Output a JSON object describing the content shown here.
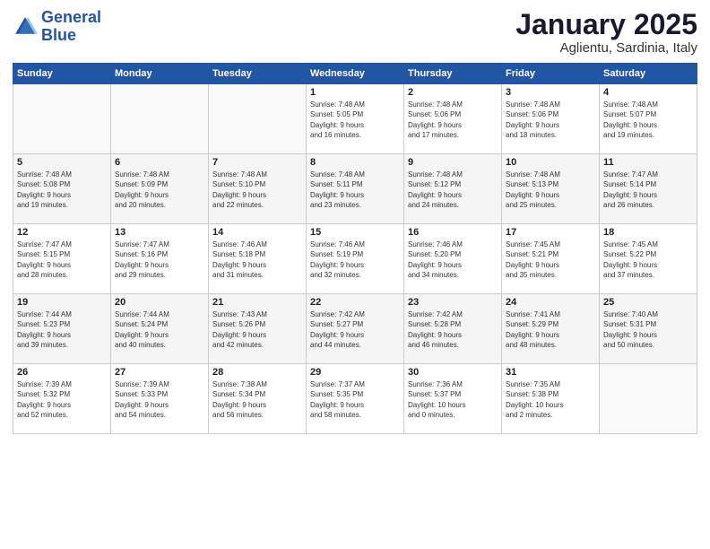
{
  "logo": {
    "line1": "General",
    "line2": "Blue"
  },
  "calendar": {
    "title": "January 2025",
    "subtitle": "Aglientu, Sardinia, Italy"
  },
  "days_header": [
    "Sunday",
    "Monday",
    "Tuesday",
    "Wednesday",
    "Thursday",
    "Friday",
    "Saturday"
  ],
  "weeks": [
    [
      {
        "day": "",
        "info": ""
      },
      {
        "day": "",
        "info": ""
      },
      {
        "day": "",
        "info": ""
      },
      {
        "day": "1",
        "info": "Sunrise: 7:48 AM\nSunset: 5:05 PM\nDaylight: 9 hours\nand 16 minutes."
      },
      {
        "day": "2",
        "info": "Sunrise: 7:48 AM\nSunset: 5:06 PM\nDaylight: 9 hours\nand 17 minutes."
      },
      {
        "day": "3",
        "info": "Sunrise: 7:48 AM\nSunset: 5:06 PM\nDaylight: 9 hours\nand 18 minutes."
      },
      {
        "day": "4",
        "info": "Sunrise: 7:48 AM\nSunset: 5:07 PM\nDaylight: 9 hours\nand 19 minutes."
      }
    ],
    [
      {
        "day": "5",
        "info": "Sunrise: 7:48 AM\nSunset: 5:08 PM\nDaylight: 9 hours\nand 19 minutes."
      },
      {
        "day": "6",
        "info": "Sunrise: 7:48 AM\nSunset: 5:09 PM\nDaylight: 9 hours\nand 20 minutes."
      },
      {
        "day": "7",
        "info": "Sunrise: 7:48 AM\nSunset: 5:10 PM\nDaylight: 9 hours\nand 22 minutes."
      },
      {
        "day": "8",
        "info": "Sunrise: 7:48 AM\nSunset: 5:11 PM\nDaylight: 9 hours\nand 23 minutes."
      },
      {
        "day": "9",
        "info": "Sunrise: 7:48 AM\nSunset: 5:12 PM\nDaylight: 9 hours\nand 24 minutes."
      },
      {
        "day": "10",
        "info": "Sunrise: 7:48 AM\nSunset: 5:13 PM\nDaylight: 9 hours\nand 25 minutes."
      },
      {
        "day": "11",
        "info": "Sunrise: 7:47 AM\nSunset: 5:14 PM\nDaylight: 9 hours\nand 26 minutes."
      }
    ],
    [
      {
        "day": "12",
        "info": "Sunrise: 7:47 AM\nSunset: 5:15 PM\nDaylight: 9 hours\nand 28 minutes."
      },
      {
        "day": "13",
        "info": "Sunrise: 7:47 AM\nSunset: 5:16 PM\nDaylight: 9 hours\nand 29 minutes."
      },
      {
        "day": "14",
        "info": "Sunrise: 7:46 AM\nSunset: 5:18 PM\nDaylight: 9 hours\nand 31 minutes."
      },
      {
        "day": "15",
        "info": "Sunrise: 7:46 AM\nSunset: 5:19 PM\nDaylight: 9 hours\nand 32 minutes."
      },
      {
        "day": "16",
        "info": "Sunrise: 7:46 AM\nSunset: 5:20 PM\nDaylight: 9 hours\nand 34 minutes."
      },
      {
        "day": "17",
        "info": "Sunrise: 7:45 AM\nSunset: 5:21 PM\nDaylight: 9 hours\nand 35 minutes."
      },
      {
        "day": "18",
        "info": "Sunrise: 7:45 AM\nSunset: 5:22 PM\nDaylight: 9 hours\nand 37 minutes."
      }
    ],
    [
      {
        "day": "19",
        "info": "Sunrise: 7:44 AM\nSunset: 5:23 PM\nDaylight: 9 hours\nand 39 minutes."
      },
      {
        "day": "20",
        "info": "Sunrise: 7:44 AM\nSunset: 5:24 PM\nDaylight: 9 hours\nand 40 minutes."
      },
      {
        "day": "21",
        "info": "Sunrise: 7:43 AM\nSunset: 5:26 PM\nDaylight: 9 hours\nand 42 minutes."
      },
      {
        "day": "22",
        "info": "Sunrise: 7:42 AM\nSunset: 5:27 PM\nDaylight: 9 hours\nand 44 minutes."
      },
      {
        "day": "23",
        "info": "Sunrise: 7:42 AM\nSunset: 5:28 PM\nDaylight: 9 hours\nand 46 minutes."
      },
      {
        "day": "24",
        "info": "Sunrise: 7:41 AM\nSunset: 5:29 PM\nDaylight: 9 hours\nand 48 minutes."
      },
      {
        "day": "25",
        "info": "Sunrise: 7:40 AM\nSunset: 5:31 PM\nDaylight: 9 hours\nand 50 minutes."
      }
    ],
    [
      {
        "day": "26",
        "info": "Sunrise: 7:39 AM\nSunset: 5:32 PM\nDaylight: 9 hours\nand 52 minutes."
      },
      {
        "day": "27",
        "info": "Sunrise: 7:39 AM\nSunset: 5:33 PM\nDaylight: 9 hours\nand 54 minutes."
      },
      {
        "day": "28",
        "info": "Sunrise: 7:38 AM\nSunset: 5:34 PM\nDaylight: 9 hours\nand 56 minutes."
      },
      {
        "day": "29",
        "info": "Sunrise: 7:37 AM\nSunset: 5:35 PM\nDaylight: 9 hours\nand 58 minutes."
      },
      {
        "day": "30",
        "info": "Sunrise: 7:36 AM\nSunset: 5:37 PM\nDaylight: 10 hours\nand 0 minutes."
      },
      {
        "day": "31",
        "info": "Sunrise: 7:35 AM\nSunset: 5:38 PM\nDaylight: 10 hours\nand 2 minutes."
      },
      {
        "day": "",
        "info": ""
      }
    ]
  ]
}
